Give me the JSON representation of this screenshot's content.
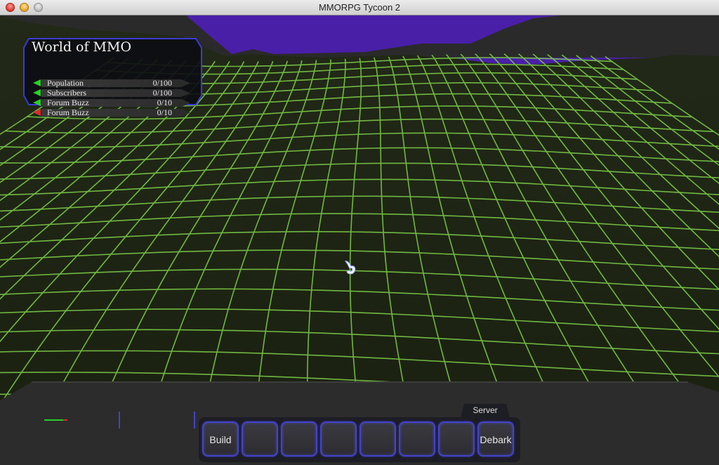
{
  "window": {
    "title": "MMORPG Tycoon 2"
  },
  "hud": {
    "world_name": "World of MMO",
    "stats": [
      {
        "label": "Population",
        "value": "0/100",
        "trend": "up",
        "color": "#27d127"
      },
      {
        "label": "Subscribers",
        "value": "0/100",
        "trend": "up",
        "color": "#27d127"
      },
      {
        "label": "Forum Buzz",
        "value": "0/10",
        "trend": "up",
        "color": "#27d127"
      },
      {
        "label": "Forum Buzz",
        "value": "0/10",
        "trend": "down",
        "color": "#e02828"
      }
    ]
  },
  "toolbar": {
    "tab_label": "Server",
    "slots": [
      {
        "label": "Build"
      },
      {
        "label": ""
      },
      {
        "label": ""
      },
      {
        "label": ""
      },
      {
        "label": ""
      },
      {
        "label": ""
      },
      {
        "label": ""
      },
      {
        "label": "Debark"
      }
    ]
  },
  "colors": {
    "sky": "#4a1fa8",
    "grid": "#7fd24a",
    "terrain": "#1e2410",
    "slot_border": "#4343c8"
  },
  "icons": {
    "cursor": "pointer-hand-icon"
  }
}
